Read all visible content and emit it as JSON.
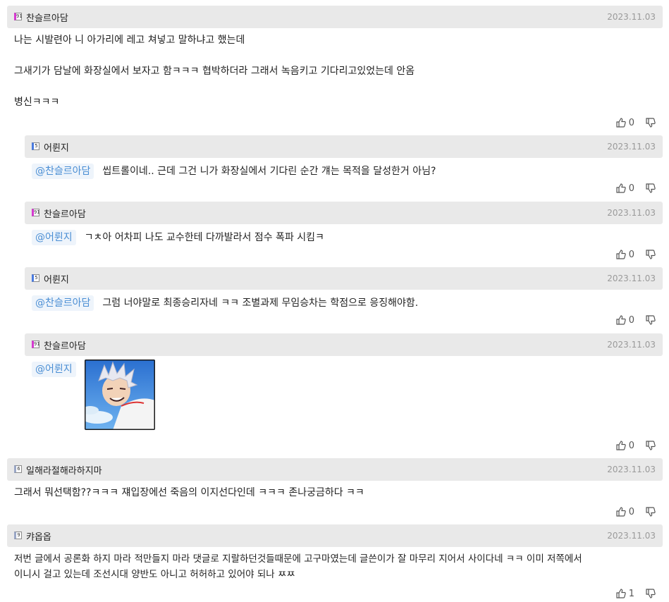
{
  "comments": [
    {
      "nick": "찬슬르아담",
      "badge": "91",
      "date": "2023.11.03",
      "paragraphs": [
        "나는 시발련아 니 아가리에 레고 쳐넣고 말하냐고 했는데",
        "",
        "그새기가 담날에 화장실에서 보자고 함ㅋㅋㅋ 협박하더라 그래서 녹음키고 기다리고있었는데 안옴",
        "",
        "병신ㅋㅋㅋ"
      ],
      "up": "0"
    },
    {
      "nick": "어륀지",
      "badge": "5",
      "date": "2023.11.03",
      "mention": "@찬슬르아담",
      "text": "씹트롤이네.. 근데 그건 니가 화장실에서 기다린 순간 걔는 목적을 달성한거 아님?",
      "up": "0"
    },
    {
      "nick": "찬슬르아담",
      "badge": "91",
      "date": "2023.11.03",
      "mention": "@어륀지",
      "text": "ㄱㅊ아 어차피 나도 교수한테 다까발라서 점수 폭파 시킴ㅋ",
      "up": "0"
    },
    {
      "nick": "어륀지",
      "badge": "5",
      "date": "2023.11.03",
      "mention": "@찬슬르아담",
      "text": "그럼 너야말로 최종승리자네 ㅋㅋ 조별과제 무임승차는 학점으로 응징해야함.",
      "up": "0"
    },
    {
      "nick": "찬슬르아담",
      "badge": "91",
      "date": "2023.11.03",
      "mention": "@어륀지",
      "up": "0"
    },
    {
      "nick": "일해라절해라하지마",
      "badge": "6",
      "date": "2023.11.03",
      "text": "그래서 뭐선택함??ㅋㅋㅋ 쟤입장에선 죽음의 이지선다인데 ㅋㅋㅋ 존나궁금하다 ㅋㅋ",
      "up": "0"
    },
    {
      "nick": "캬옵옵",
      "badge": "9",
      "date": "2023.11.03",
      "paragraphs": [
        "저번 글에서 공론화 하지 마라 적만들지 마라 댓글로 지랄하던것들때문에 고구마였는데 글쓴이가 잘 마무리 지어서 사이다네 ㅋㅋ 이미 저쪽에서",
        "이니시 걸고 있는데 조선시대 양반도 아니고 허허하고 있어야 되나 ㅉㅉ"
      ],
      "up": "1"
    }
  ],
  "colors": {
    "header_bg": "#e9e9e9",
    "mention_text": "#4a8ed4",
    "mention_bg": "#eef4fb",
    "date_text": "#9a9a9a"
  },
  "icons": [
    "thumbs-up-icon",
    "thumbs-down-icon",
    "level-badge-icon"
  ]
}
